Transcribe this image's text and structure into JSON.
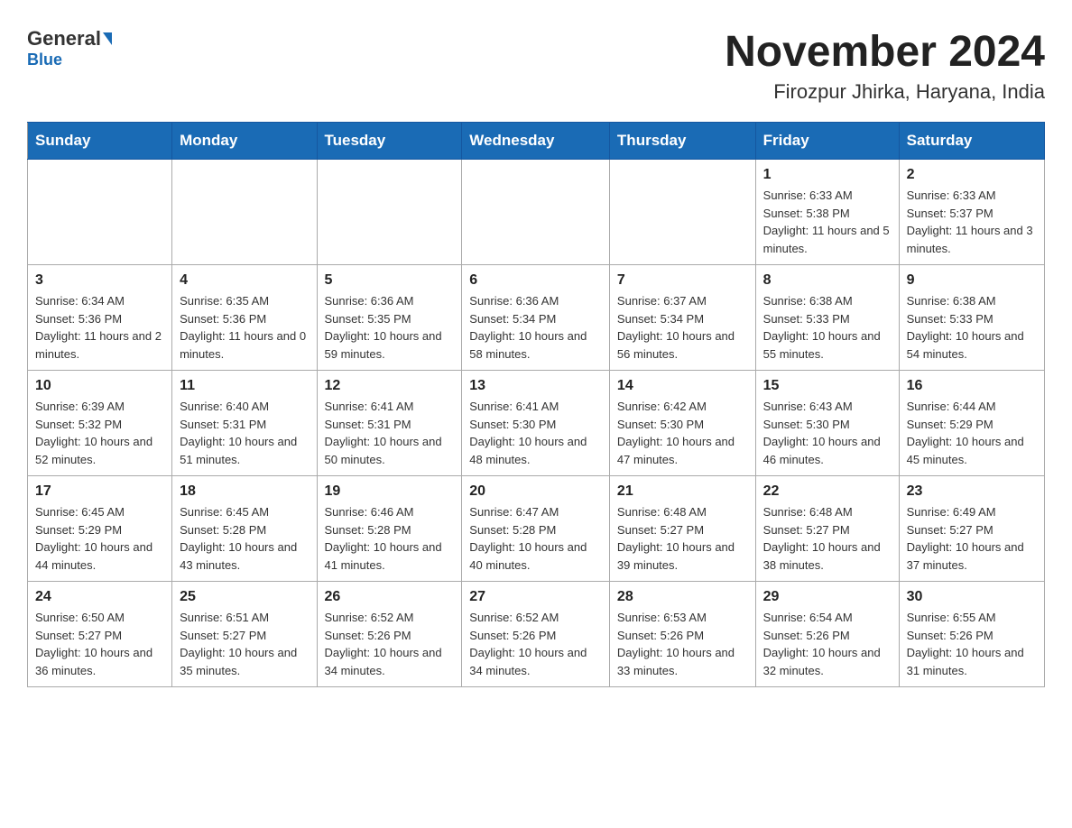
{
  "header": {
    "logo_main": "General",
    "logo_sub": "Blue",
    "month_title": "November 2024",
    "location": "Firozpur Jhirka, Haryana, India"
  },
  "days_of_week": [
    "Sunday",
    "Monday",
    "Tuesday",
    "Wednesday",
    "Thursday",
    "Friday",
    "Saturday"
  ],
  "weeks": [
    [
      {
        "day": "",
        "info": ""
      },
      {
        "day": "",
        "info": ""
      },
      {
        "day": "",
        "info": ""
      },
      {
        "day": "",
        "info": ""
      },
      {
        "day": "",
        "info": ""
      },
      {
        "day": "1",
        "info": "Sunrise: 6:33 AM\nSunset: 5:38 PM\nDaylight: 11 hours and 5 minutes."
      },
      {
        "day": "2",
        "info": "Sunrise: 6:33 AM\nSunset: 5:37 PM\nDaylight: 11 hours and 3 minutes."
      }
    ],
    [
      {
        "day": "3",
        "info": "Sunrise: 6:34 AM\nSunset: 5:36 PM\nDaylight: 11 hours and 2 minutes."
      },
      {
        "day": "4",
        "info": "Sunrise: 6:35 AM\nSunset: 5:36 PM\nDaylight: 11 hours and 0 minutes."
      },
      {
        "day": "5",
        "info": "Sunrise: 6:36 AM\nSunset: 5:35 PM\nDaylight: 10 hours and 59 minutes."
      },
      {
        "day": "6",
        "info": "Sunrise: 6:36 AM\nSunset: 5:34 PM\nDaylight: 10 hours and 58 minutes."
      },
      {
        "day": "7",
        "info": "Sunrise: 6:37 AM\nSunset: 5:34 PM\nDaylight: 10 hours and 56 minutes."
      },
      {
        "day": "8",
        "info": "Sunrise: 6:38 AM\nSunset: 5:33 PM\nDaylight: 10 hours and 55 minutes."
      },
      {
        "day": "9",
        "info": "Sunrise: 6:38 AM\nSunset: 5:33 PM\nDaylight: 10 hours and 54 minutes."
      }
    ],
    [
      {
        "day": "10",
        "info": "Sunrise: 6:39 AM\nSunset: 5:32 PM\nDaylight: 10 hours and 52 minutes."
      },
      {
        "day": "11",
        "info": "Sunrise: 6:40 AM\nSunset: 5:31 PM\nDaylight: 10 hours and 51 minutes."
      },
      {
        "day": "12",
        "info": "Sunrise: 6:41 AM\nSunset: 5:31 PM\nDaylight: 10 hours and 50 minutes."
      },
      {
        "day": "13",
        "info": "Sunrise: 6:41 AM\nSunset: 5:30 PM\nDaylight: 10 hours and 48 minutes."
      },
      {
        "day": "14",
        "info": "Sunrise: 6:42 AM\nSunset: 5:30 PM\nDaylight: 10 hours and 47 minutes."
      },
      {
        "day": "15",
        "info": "Sunrise: 6:43 AM\nSunset: 5:30 PM\nDaylight: 10 hours and 46 minutes."
      },
      {
        "day": "16",
        "info": "Sunrise: 6:44 AM\nSunset: 5:29 PM\nDaylight: 10 hours and 45 minutes."
      }
    ],
    [
      {
        "day": "17",
        "info": "Sunrise: 6:45 AM\nSunset: 5:29 PM\nDaylight: 10 hours and 44 minutes."
      },
      {
        "day": "18",
        "info": "Sunrise: 6:45 AM\nSunset: 5:28 PM\nDaylight: 10 hours and 43 minutes."
      },
      {
        "day": "19",
        "info": "Sunrise: 6:46 AM\nSunset: 5:28 PM\nDaylight: 10 hours and 41 minutes."
      },
      {
        "day": "20",
        "info": "Sunrise: 6:47 AM\nSunset: 5:28 PM\nDaylight: 10 hours and 40 minutes."
      },
      {
        "day": "21",
        "info": "Sunrise: 6:48 AM\nSunset: 5:27 PM\nDaylight: 10 hours and 39 minutes."
      },
      {
        "day": "22",
        "info": "Sunrise: 6:48 AM\nSunset: 5:27 PM\nDaylight: 10 hours and 38 minutes."
      },
      {
        "day": "23",
        "info": "Sunrise: 6:49 AM\nSunset: 5:27 PM\nDaylight: 10 hours and 37 minutes."
      }
    ],
    [
      {
        "day": "24",
        "info": "Sunrise: 6:50 AM\nSunset: 5:27 PM\nDaylight: 10 hours and 36 minutes."
      },
      {
        "day": "25",
        "info": "Sunrise: 6:51 AM\nSunset: 5:27 PM\nDaylight: 10 hours and 35 minutes."
      },
      {
        "day": "26",
        "info": "Sunrise: 6:52 AM\nSunset: 5:26 PM\nDaylight: 10 hours and 34 minutes."
      },
      {
        "day": "27",
        "info": "Sunrise: 6:52 AM\nSunset: 5:26 PM\nDaylight: 10 hours and 34 minutes."
      },
      {
        "day": "28",
        "info": "Sunrise: 6:53 AM\nSunset: 5:26 PM\nDaylight: 10 hours and 33 minutes."
      },
      {
        "day": "29",
        "info": "Sunrise: 6:54 AM\nSunset: 5:26 PM\nDaylight: 10 hours and 32 minutes."
      },
      {
        "day": "30",
        "info": "Sunrise: 6:55 AM\nSunset: 5:26 PM\nDaylight: 10 hours and 31 minutes."
      }
    ]
  ]
}
